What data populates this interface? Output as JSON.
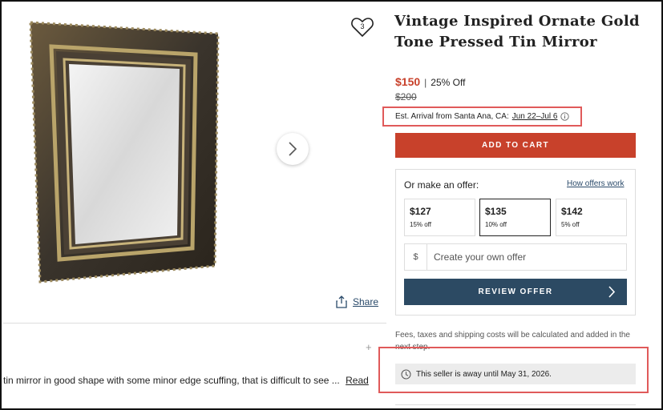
{
  "product": {
    "title": "Vintage Inspired Ornate Gold Tone Pressed Tin Mirror",
    "price": "$150",
    "separator": "|",
    "discount": "25% Off",
    "original_price": "$200",
    "favorite_count": "3"
  },
  "shipping": {
    "arrival_prefix": "Est. Arrival from Santa Ana, CA:",
    "arrival_dates": "Jun 22–Jul 6"
  },
  "buttons": {
    "add_to_cart": "ADD TO CART",
    "review_offer": "REVIEW OFFER",
    "share": "Share"
  },
  "offer": {
    "title": "Or make an offer:",
    "how_link": "How offers work",
    "options": [
      {
        "amount": "$127",
        "pct": "15% off",
        "selected": false
      },
      {
        "amount": "$135",
        "pct": "10% off",
        "selected": true
      },
      {
        "amount": "$142",
        "pct": "5% off",
        "selected": false
      }
    ],
    "currency_symbol": "$",
    "custom_placeholder": "Create your own offer"
  },
  "fees_note": "Fees, taxes and shipping costs will be calculated and added in the next step.",
  "seller_status": "This seller is away until May 31, 2026.",
  "description": {
    "text": "tin mirror in good shape with some minor edge scuffing, that is difficult to see ...",
    "read_more": "Read"
  },
  "misc": {
    "plus_glyph": "+"
  },
  "colors": {
    "accent_red": "#c8412b",
    "navy": "#2c4a63",
    "highlight_red": "#e05a5a"
  }
}
